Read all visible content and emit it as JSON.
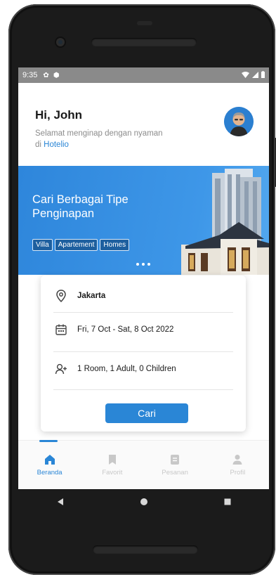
{
  "status_bar": {
    "time": "9:35",
    "icons": [
      "settings-icon",
      "shield-icon",
      "wifi-icon",
      "signal-icon",
      "battery-icon"
    ]
  },
  "header": {
    "greeting": "Hi, John",
    "subtitle_prefix": "Selamat menginap dengan nyaman di",
    "brand": "Hotelio"
  },
  "banner": {
    "title": "Cari Berbagai Tipe Penginapan",
    "tags": [
      "Villa",
      "Apartement",
      "Homes"
    ]
  },
  "search": {
    "location": "Jakarta",
    "dates": "Fri, 7 Oct - Sat, 8 Oct 2022",
    "guests": "1 Room, 1 Adult, 0 Children",
    "button_label": "Cari"
  },
  "bottom_nav": {
    "items": [
      {
        "label": "Beranda",
        "icon": "home-icon",
        "active": true
      },
      {
        "label": "Favorit",
        "icon": "bookmark-icon",
        "active": false
      },
      {
        "label": "Pesanan",
        "icon": "orders-icon",
        "active": false
      },
      {
        "label": "Profil",
        "icon": "profile-icon",
        "active": false
      }
    ]
  },
  "colors": {
    "primary": "#2a86d6",
    "banner": "#3e97e8",
    "tag_bg": "#1d5f9f",
    "muted": "#8c8c8c"
  }
}
